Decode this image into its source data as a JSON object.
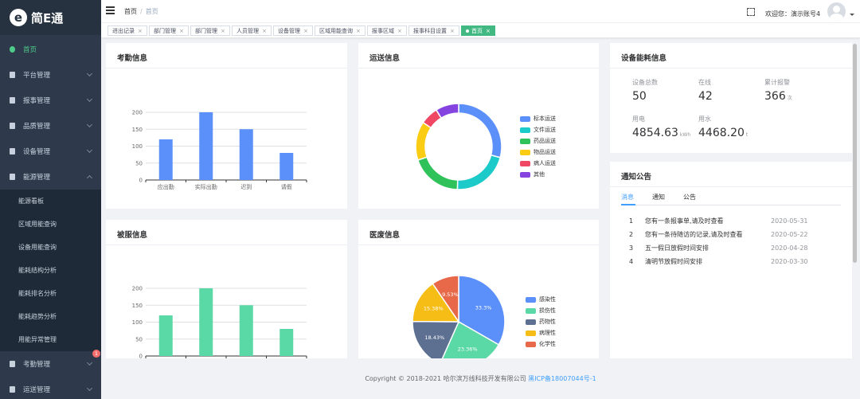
{
  "app": {
    "logo_mark": "e",
    "logo_text": "简E通"
  },
  "sidebar": {
    "items": [
      {
        "label": "首页",
        "active": true
      },
      {
        "label": "平台管理"
      },
      {
        "label": "报事管理"
      },
      {
        "label": "品质管理"
      },
      {
        "label": "设备管理"
      },
      {
        "label": "能源管理",
        "expanded": true
      }
    ],
    "submenu": [
      "能源看板",
      "区域用能查询",
      "设备用能查询",
      "能耗结构分析",
      "能耗排名分析",
      "能耗趋势分析",
      "用能异常管理"
    ],
    "bottom_items": [
      {
        "label": "考勤管理",
        "badge": "1"
      },
      {
        "label": "运送管理"
      }
    ]
  },
  "topbar": {
    "breadcrumb": [
      "首页",
      "首页"
    ],
    "welcome": "欢迎您：演示账号4"
  },
  "tags": [
    {
      "label": "进出记录"
    },
    {
      "label": "部门管理"
    },
    {
      "label": "部门管理"
    },
    {
      "label": "人员管理"
    },
    {
      "label": "设备管理"
    },
    {
      "label": "区域用能查询"
    },
    {
      "label": "报事区域"
    },
    {
      "label": "报事科目设置"
    },
    {
      "label": "首页",
      "active": true
    }
  ],
  "cards": {
    "attendance": {
      "title": "考勤信息"
    },
    "transport": {
      "title": "运送信息"
    },
    "energy": {
      "title": "设备能耗信息",
      "stats": [
        {
          "label": "设备总数",
          "value": "50",
          "unit": ""
        },
        {
          "label": "在线",
          "value": "42",
          "unit": ""
        },
        {
          "label": "累计报警",
          "value": "366",
          "unit": "次"
        },
        {
          "label": "用电",
          "value": "4854.63",
          "unit": "kWh"
        },
        {
          "label": "用水",
          "value": "4468.20",
          "unit": "t"
        }
      ]
    },
    "uniform": {
      "title": "被服信息"
    },
    "waste": {
      "title": "医废信息"
    },
    "notice": {
      "title": "通知公告",
      "tabs": [
        "消息",
        "通知",
        "公告"
      ],
      "rows": [
        {
          "num": "1",
          "text": "您有一条报事单,请及时查看",
          "date": "2020-05-31"
        },
        {
          "num": "2",
          "text": "您有一条待随访的记录,请及时查看",
          "date": "2020-05-22"
        },
        {
          "num": "3",
          "text": "五一假日放假时间安排",
          "date": "2020-04-28"
        },
        {
          "num": "4",
          "text": "清明节放假时间安排",
          "date": "2020-03-30"
        }
      ]
    }
  },
  "chart_data": [
    {
      "type": "bar",
      "categories": [
        "应出勤",
        "实际出勤",
        "迟到",
        "请假"
      ],
      "values": [
        120,
        200,
        150,
        80
      ],
      "ylim": [
        0,
        200
      ],
      "yticks": [
        0,
        50,
        100,
        150,
        200
      ],
      "color": "#5b8ff9",
      "grid": true
    },
    {
      "type": "pie",
      "donut": true,
      "categories": [
        "标本运送",
        "文件运送",
        "药品运送",
        "物品运送",
        "病人运送",
        "其他"
      ],
      "values": [
        30,
        22,
        20,
        15,
        7,
        9
      ],
      "colors": [
        "#5b8ff9",
        "#1ccaca",
        "#2fc25b",
        "#facc14",
        "#f04864",
        "#8543e0"
      ],
      "legend": "right"
    },
    {
      "type": "bar",
      "categories": [
        "",
        "",
        "",
        ""
      ],
      "values": [
        120,
        200,
        150,
        80
      ],
      "ylim": [
        0,
        200
      ],
      "yticks": [
        0,
        50,
        100,
        150,
        200
      ],
      "color": "#5ad8a6",
      "grid": true
    },
    {
      "type": "pie",
      "categories": [
        "感染性",
        "损伤性",
        "药物性",
        "病理性",
        "化学性"
      ],
      "values": [
        33.3,
        23.36,
        18.43,
        15.38,
        9.53
      ],
      "labels": [
        "33.3%",
        "23.36%",
        "18.43%",
        "15.38%",
        "9.53%"
      ],
      "colors": [
        "#5b8ff9",
        "#5ad8a6",
        "#5d7092",
        "#f6bd16",
        "#e8684a"
      ],
      "legend": "right"
    }
  ],
  "footer": {
    "text": "Copyright © 2018-2021 哈尔滨万线科技开发有限公司 ",
    "icp": "黑ICP备18007044号-1"
  }
}
